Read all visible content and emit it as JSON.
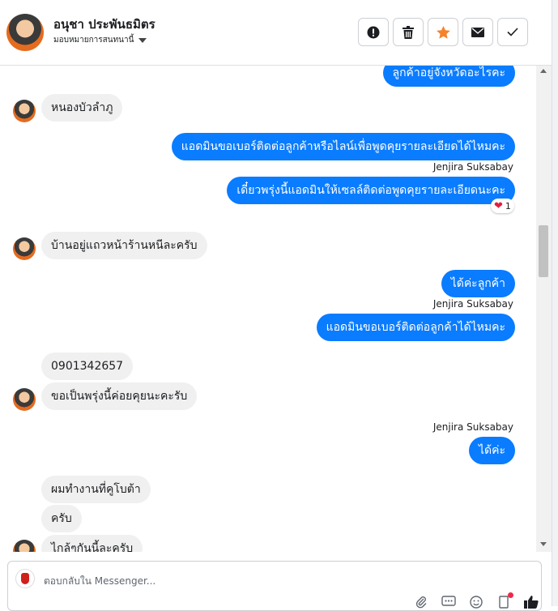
{
  "header": {
    "contact_name": "อนุชา ประพันธมิตร",
    "assign_label": "มอบหมายการสนทนานี้"
  },
  "actions": [
    {
      "name": "spam-button",
      "icon": "alert-circle-icon"
    },
    {
      "name": "delete-button",
      "icon": "trash-icon"
    },
    {
      "name": "star-button",
      "icon": "star-icon",
      "color": "#f5822b"
    },
    {
      "name": "mark-unread-button",
      "icon": "envelope-icon"
    },
    {
      "name": "mark-done-button",
      "icon": "checkmark-icon"
    }
  ],
  "messages": {
    "m1": "ลูกค้าอยู่จังหวัดอะไรคะ",
    "m2": "หนองบัวลำภู",
    "m3": "แอดมินขอเบอร์ติดต่อลูกค้าหรือไลน์เพื่อพูดคุยรายละเอียดได้ไหมคะ",
    "m3_sender": "Jenjira Suksabay",
    "m4": "เดี๋ยวพรุ่งนี้แอดมินให้เซลล์ติดต่อพูดคุยรายละเอียดนะคะ",
    "m4_reaction_count": "1",
    "m5": "บ้านอยู่แถวหน้าร้านหนีละครับ",
    "m6": "ได้ค่ะลูกค้า",
    "m6_sender": "Jenjira Suksabay",
    "m7": "แอดมินขอเบอร์ติดต่อลูกค้าได้ไหมคะ",
    "m8": "0901342657",
    "m9": "ขอเป็นพรุ่งนี้ค่อยคุยนะคะรับ",
    "m10_sender": "Jenjira Suksabay",
    "m10": "ได้ค่ะ",
    "m11": "ผมทำงานที่คูโบต้า",
    "m12": "ครับ",
    "m13": "ไกล้ๆกันนี้ละครับ"
  },
  "composer": {
    "placeholder": "ตอบกลับใน Messenger..."
  },
  "colors": {
    "outgoing_bubble": "#0a7cff",
    "incoming_bubble": "#f0f0f0",
    "accent_star": "#f5822b"
  }
}
